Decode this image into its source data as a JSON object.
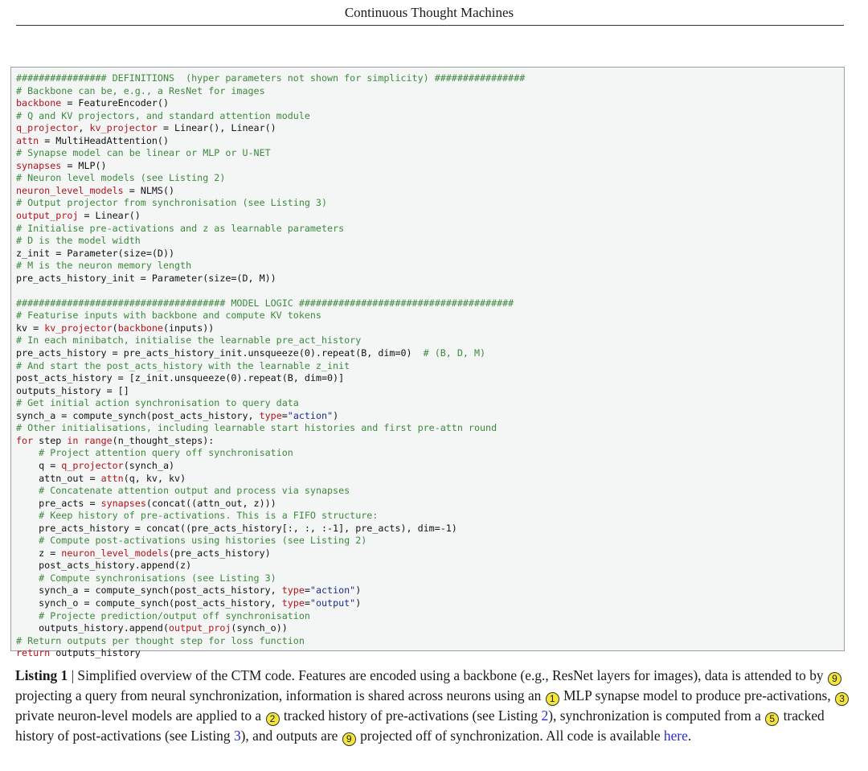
{
  "running_head": "Continuous Thought Machines",
  "code": [
    [
      [
        "c",
        "################ DEFINITIONS  (hyper parameters not shown for simplicity) ################"
      ]
    ],
    [
      [
        "c",
        "# Backbone can be, e.g., a ResNet for images"
      ]
    ],
    [
      [
        "k",
        "backbone"
      ],
      [
        "t",
        " = FeatureEncoder()"
      ]
    ],
    [
      [
        "c",
        "# Q and KV projectors, and standard attention module"
      ]
    ],
    [
      [
        "k",
        "q_projector"
      ],
      [
        "t",
        ", "
      ],
      [
        "k",
        "kv_projector"
      ],
      [
        "t",
        " = Linear(), Linear()"
      ]
    ],
    [
      [
        "k",
        "attn"
      ],
      [
        "t",
        " = MultiHeadAttention()"
      ]
    ],
    [
      [
        "c",
        "# Synapse model can be linear or MLP or U-NET"
      ]
    ],
    [
      [
        "k",
        "synapses"
      ],
      [
        "t",
        " = MLP()"
      ]
    ],
    [
      [
        "c",
        "# Neuron level models (see Listing 2)"
      ]
    ],
    [
      [
        "k",
        "neuron_level_models"
      ],
      [
        "t",
        " = NLMS()"
      ]
    ],
    [
      [
        "c",
        "# Output projector from synchronisation (see Listing 3)"
      ]
    ],
    [
      [
        "k",
        "output_proj"
      ],
      [
        "t",
        " = Linear()"
      ]
    ],
    [
      [
        "c",
        "# Initialise pre-activations and z as learnable parameters"
      ]
    ],
    [
      [
        "c",
        "# D is the model width"
      ]
    ],
    [
      [
        "t",
        "z_init = Parameter(size=(D))"
      ]
    ],
    [
      [
        "c",
        "# M is the neuron memory length"
      ]
    ],
    [
      [
        "t",
        "pre_acts_history_init = Parameter(size=(D, M))"
      ]
    ],
    [
      [
        "t",
        ""
      ]
    ],
    [
      [
        "c",
        "##################################### MODEL LOGIC ######################################"
      ]
    ],
    [
      [
        "c",
        "# Featurise inputs with backbone and compute KV tokens"
      ]
    ],
    [
      [
        "t",
        "kv = "
      ],
      [
        "k",
        "kv_projector"
      ],
      [
        "t",
        "("
      ],
      [
        "k",
        "backbone"
      ],
      [
        "t",
        "(inputs))"
      ]
    ],
    [
      [
        "c",
        "# In each minibatch, initialise the learnable pre_act_history"
      ]
    ],
    [
      [
        "t",
        "pre_acts_history = pre_acts_history_init.unsqueeze(0).repeat(B, dim=0)  "
      ],
      [
        "c",
        "# (B, D, M)"
      ]
    ],
    [
      [
        "c",
        "# And start the post_acts_history with the learnable z_init"
      ]
    ],
    [
      [
        "t",
        "post_acts_history = [z_init.unsqueeze(0).repeat(B, dim=0)]"
      ]
    ],
    [
      [
        "t",
        "outputs_history = []"
      ]
    ],
    [
      [
        "c",
        "# Get initial action synchronisation to query data"
      ]
    ],
    [
      [
        "t",
        "synch_a = compute_synch(post_acts_history, "
      ],
      [
        "k",
        "type"
      ],
      [
        "t",
        "="
      ],
      [
        "s",
        "\"action\""
      ],
      [
        "t",
        ")"
      ]
    ],
    [
      [
        "c",
        "# Other initialisations, including learnable start histories and first pre-attn round"
      ]
    ],
    [
      [
        "k",
        "for"
      ],
      [
        "t",
        " step "
      ],
      [
        "k",
        "in"
      ],
      [
        "t",
        " "
      ],
      [
        "k",
        "range"
      ],
      [
        "t",
        "(n_thought_steps):"
      ]
    ],
    [
      [
        "t",
        "    "
      ],
      [
        "c",
        "# Project attention query off synchronisation"
      ]
    ],
    [
      [
        "t",
        "    q = "
      ],
      [
        "k",
        "q_projector"
      ],
      [
        "t",
        "(synch_a)"
      ]
    ],
    [
      [
        "t",
        "    attn_out = "
      ],
      [
        "k",
        "attn"
      ],
      [
        "t",
        "(q, kv, kv)"
      ]
    ],
    [
      [
        "t",
        "    "
      ],
      [
        "c",
        "# Concatenate attention output and process via synapses"
      ]
    ],
    [
      [
        "t",
        "    pre_acts = "
      ],
      [
        "k",
        "synapses"
      ],
      [
        "t",
        "(concat((attn_out, z)))"
      ]
    ],
    [
      [
        "t",
        "    "
      ],
      [
        "c",
        "# Keep history of pre-activations. This is a FIFO structure:"
      ]
    ],
    [
      [
        "t",
        "    pre_acts_history = concat((pre_acts_history[:, :, :-1], pre_acts), dim=-1)"
      ]
    ],
    [
      [
        "t",
        "    "
      ],
      [
        "c",
        "# Compute post-activations using histories (see Listing 2)"
      ]
    ],
    [
      [
        "t",
        "    z = "
      ],
      [
        "k",
        "neuron_level_models"
      ],
      [
        "t",
        "(pre_acts_history)"
      ]
    ],
    [
      [
        "t",
        "    post_acts_history.append(z)"
      ]
    ],
    [
      [
        "t",
        "    "
      ],
      [
        "c",
        "# Compute synchronisations (see Listing 3)"
      ]
    ],
    [
      [
        "t",
        "    synch_a = compute_synch(post_acts_history, "
      ],
      [
        "k",
        "type"
      ],
      [
        "t",
        "="
      ],
      [
        "s",
        "\"action\""
      ],
      [
        "t",
        ")"
      ]
    ],
    [
      [
        "t",
        "    synch_o = compute_synch(post_acts_history, "
      ],
      [
        "k",
        "type"
      ],
      [
        "t",
        "="
      ],
      [
        "s",
        "\"output\""
      ],
      [
        "t",
        ")"
      ]
    ],
    [
      [
        "t",
        "    "
      ],
      [
        "c",
        "# Projecte prediction/output off synchronisation"
      ]
    ],
    [
      [
        "t",
        "    outputs_history.append("
      ],
      [
        "k",
        "output_proj"
      ],
      [
        "t",
        "(synch_o))"
      ]
    ],
    [
      [
        "c",
        "# Return outputs per thought step for loss function"
      ]
    ],
    [
      [
        "k",
        "return"
      ],
      [
        "t",
        " outputs_history"
      ]
    ]
  ],
  "caption": {
    "label": "Listing 1",
    "sep": " | ",
    "t1": "Simplified overview of the CTM code. Features are encoded using a backbone (e.g., ResNet layers for images), data is attended to by ",
    "m1": "9",
    "t2": " projecting a query from neural synchronization, information is shared across neurons using an ",
    "m2": "1",
    "t3": " MLP synapse model to produce pre-activations, ",
    "m3": "3",
    "t4": " private neuron-level models are applied to a ",
    "m4": "2",
    "t5": " tracked history of pre-activations (see Listing ",
    "ref1": "2",
    "t6": "), synchronization is computed from a ",
    "m5": "5",
    "t7": " tracked history of post-activations (see Listing ",
    "ref2": "3",
    "t8": "), and outputs are ",
    "m6": "9",
    "t9": " projected off of synchronization. All code is available ",
    "link": "here",
    "t10": "."
  }
}
